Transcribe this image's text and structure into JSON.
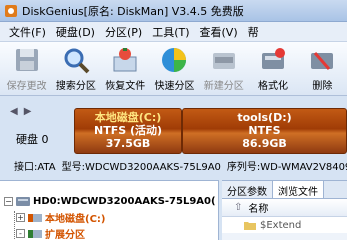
{
  "window": {
    "title": "DiskGenius[原名: DiskMan] V3.4.5 免费版"
  },
  "menu": [
    "文件(F)",
    "硬盘(D)",
    "分区(P)",
    "工具(T)",
    "查看(V)",
    "帮"
  ],
  "toolbar": [
    {
      "label": "保存更改",
      "icon": "save-icon",
      "enabled": false
    },
    {
      "label": "搜索分区",
      "icon": "search-partition-icon",
      "enabled": true
    },
    {
      "label": "恢复文件",
      "icon": "recover-file-icon",
      "enabled": true
    },
    {
      "label": "快速分区",
      "icon": "quick-partition-icon",
      "enabled": true
    },
    {
      "label": "新建分区",
      "icon": "new-partition-icon",
      "enabled": false
    },
    {
      "label": "格式化",
      "icon": "format-icon",
      "enabled": true
    },
    {
      "label": "删除",
      "icon": "delete-icon",
      "enabled": true
    }
  ],
  "diskmap": {
    "disk_label": "硬盘 0",
    "partitions": [
      {
        "name": "本地磁盘(C:)",
        "fs": "NTFS (活动)",
        "size": "37.5GB"
      },
      {
        "name": "tools(D:)",
        "fs": "NTFS",
        "size": "86.9GB"
      }
    ],
    "info": {
      "interface": "接口:ATA",
      "model": "型号:WDCWD3200AAKS-75L9A0",
      "serial": "序列号:WD-WMAV2V840927"
    }
  },
  "tree": {
    "disk": "HD0:WDCWD3200AAKS-75L9A0(",
    "items": [
      {
        "label": "本地磁盘(C:)",
        "toggle": "+"
      },
      {
        "label": "扩展分区",
        "toggle": "-"
      }
    ]
  },
  "right_panel": {
    "tabs": [
      "分区参数",
      "浏览文件"
    ],
    "active_tab": 1,
    "column_header": "名称",
    "files": [
      "$Extend"
    ]
  },
  "colors": {
    "partition_fill": "#a8420a",
    "partition_name": "#ffe680",
    "tree_partition_text": "#d35400"
  }
}
